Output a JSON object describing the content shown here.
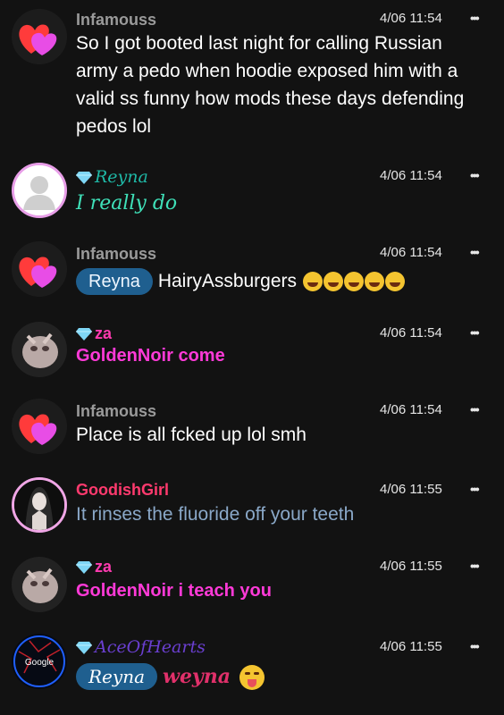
{
  "messages": [
    {
      "name": "Infamouss",
      "time": "4/06 11:54",
      "text": "So I got booted last night for calling Russian army a pedo when hoodie exposed him with a valid ss funny how mods these days defending pedos lol"
    },
    {
      "name": "Reyna",
      "time": "4/06 11:54",
      "text": "I really do"
    },
    {
      "name": "Infamouss",
      "time": "4/06 11:54",
      "mention": "Reyna",
      "text": "HairyAssburgers"
    },
    {
      "name": "za",
      "time": "4/06 11:54",
      "text": "GoldenNoir come"
    },
    {
      "name": "Infamouss",
      "time": "4/06 11:54",
      "text": "Place is all fcked up lol smh"
    },
    {
      "name": "GoodishGirl",
      "time": "4/06 11:55",
      "text": "It rinses the fluoride off your teeth"
    },
    {
      "name": "za",
      "time": "4/06 11:55",
      "text": "GoldenNoir i teach you"
    },
    {
      "name": "AceOfHearts",
      "time": "4/06 11:55",
      "mention": "Reyna",
      "text": "weyna"
    }
  ],
  "more_icon": "•••",
  "avatar_logo_text": "Google",
  "colors": {
    "background": "#121212",
    "mention_pill": "#1f5f8f",
    "reyna_name": "#1fb8a6",
    "reyna_text": "#3fe0b8",
    "za_name": "#ff3ab0",
    "za_text": "#ff3ad8",
    "goodish_name": "#ff3a6e",
    "goodish_text": "#8aa8c8",
    "ace_name": "#6a3fd0",
    "ace_text": "#e0306a",
    "infamouss_name": "#9a9a9a"
  }
}
